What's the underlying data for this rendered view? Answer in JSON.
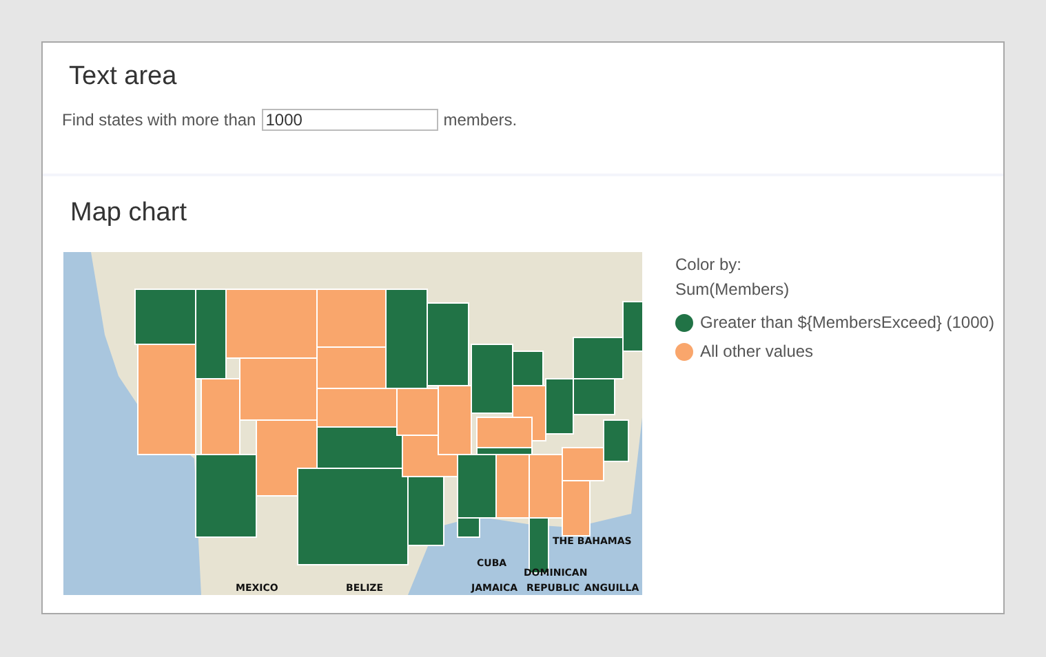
{
  "text_area": {
    "title": "Text area",
    "sentence_before": "Find states with more than",
    "input_value": "1000",
    "sentence_after": "members."
  },
  "map_chart": {
    "title": "Map chart",
    "place_labels": [
      "THE BAHAMAS",
      "CUBA",
      "DOMINICAN",
      "MEXICO",
      "BELIZE",
      "JAMAICA",
      "REPUBLIC",
      "ANGUILLA"
    ],
    "legend": {
      "heading": "Color by:",
      "measure": "Sum(Members)",
      "items": [
        {
          "label": "Greater than ${MembersExceed} (1000)",
          "color": "#217346"
        },
        {
          "label": "All other values",
          "color": "#f9a66c"
        }
      ]
    }
  }
}
